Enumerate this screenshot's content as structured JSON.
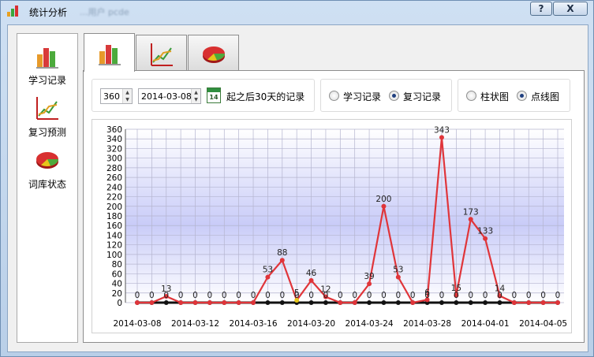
{
  "window": {
    "title": "统计分析",
    "blurred_subtitle": "...用户  pcde",
    "help_label": "?",
    "close_label": "X"
  },
  "sidebar": {
    "items": [
      {
        "label": "学习记录",
        "icon": "bar-chart-icon"
      },
      {
        "label": "复习预测",
        "icon": "line-chart-icon"
      },
      {
        "label": "词库状态",
        "icon": "pie-chart-icon"
      }
    ]
  },
  "tabs": [
    {
      "icon": "bar-chart-icon",
      "active": true
    },
    {
      "icon": "line-chart-icon",
      "active": false
    },
    {
      "icon": "pie-chart-icon",
      "active": false
    }
  ],
  "controls": {
    "days_value": "360",
    "date_value": "2014-03-08",
    "calendar_day": "14",
    "range_label": "起之后30天的记录",
    "record_options": [
      {
        "label": "学习记录",
        "selected": false
      },
      {
        "label": "复习记录",
        "selected": true
      }
    ],
    "chart_type_options": [
      {
        "label": "柱状图",
        "selected": false
      },
      {
        "label": "点线图",
        "selected": true
      }
    ]
  },
  "colors": {
    "accent_line": "#e0353a",
    "baseline": "#111111",
    "highlight_point": "#e6c619"
  },
  "chart_data": {
    "type": "line",
    "ylim": [
      0,
      360
    ],
    "yticks": [
      0,
      20,
      40,
      60,
      80,
      100,
      120,
      140,
      160,
      180,
      200,
      220,
      240,
      260,
      280,
      300,
      320,
      340,
      360
    ],
    "x_tick_labels": [
      "2014-03-08",
      "2014-03-12",
      "2014-03-16",
      "2014-03-20",
      "2014-03-24",
      "2014-03-28",
      "2014-04-01",
      "2014-04-05"
    ],
    "x": [
      "2014-03-08",
      "2014-03-09",
      "2014-03-10",
      "2014-03-11",
      "2014-03-12",
      "2014-03-13",
      "2014-03-14",
      "2014-03-15",
      "2014-03-16",
      "2014-03-17",
      "2014-03-18",
      "2014-03-19",
      "2014-03-20",
      "2014-03-21",
      "2014-03-22",
      "2014-03-23",
      "2014-03-24",
      "2014-03-25",
      "2014-03-26",
      "2014-03-27",
      "2014-03-28",
      "2014-03-29",
      "2014-03-30",
      "2014-03-31",
      "2014-04-01",
      "2014-04-02",
      "2014-04-03",
      "2014-04-04",
      "2014-04-05",
      "2014-04-06"
    ],
    "series": [
      {
        "values": [
          0,
          0,
          13,
          0,
          0,
          0,
          0,
          0,
          0,
          53,
          88,
          5,
          46,
          12,
          0,
          0,
          39,
          200,
          53,
          0,
          6,
          343,
          15,
          173,
          133,
          14,
          0,
          0,
          0,
          0
        ]
      },
      {
        "values": [
          0,
          0,
          0,
          0,
          0,
          0,
          0,
          0,
          0,
          0,
          0,
          0,
          0,
          0,
          0,
          0,
          0,
          0,
          0,
          0,
          0,
          0,
          0,
          0,
          0,
          0,
          0,
          0,
          0,
          0
        ]
      }
    ]
  }
}
